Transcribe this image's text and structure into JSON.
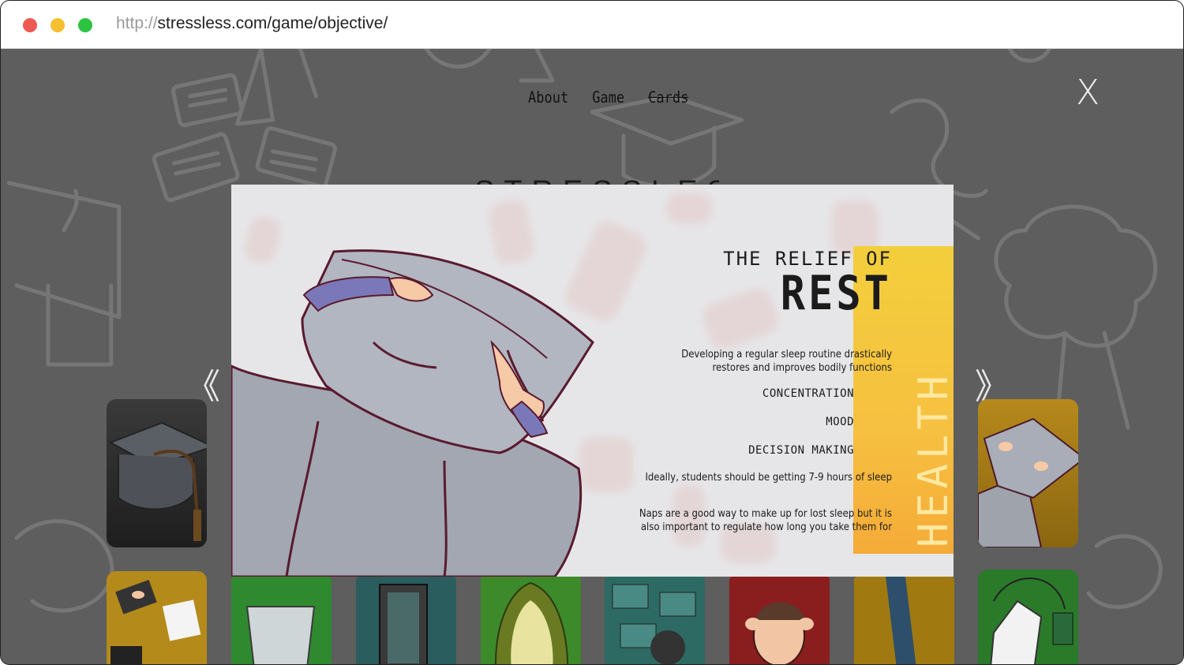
{
  "browser": {
    "url_scheme": "http://",
    "url_rest": "stressless.com/game/objective/"
  },
  "nav": {
    "about": "About",
    "game": "Game",
    "cards": "Cards"
  },
  "close_label": "X",
  "behind_title": "STRESSLESS",
  "arrows": {
    "prev": "《",
    "next": "》"
  },
  "modal": {
    "title_small": "THE RELIEF OF",
    "title_big": "REST",
    "intro_line1": "Developing a regular sleep routine drastically",
    "intro_line2": "restores and improves bodily functions",
    "benefits": [
      "CONCENTRATION",
      "MOOD",
      "DECISION MAKING"
    ],
    "hours_note": "Ideally, students should be getting 7-9 hours of sleep",
    "naps_line1": "Naps are a good way to make up for lost sleep but it is",
    "naps_line2": "also important to regulate how long you take them for",
    "category": "HEALTH"
  },
  "colors": {
    "accent_yellow": "#f5c23c",
    "background_gray": "#5e5e5e",
    "modal_bg": "#e6e6e8"
  },
  "cards": [
    {
      "name": "graduation-cap-card",
      "color": "#2b2b2b"
    },
    {
      "name": "study-desk-card",
      "color": "#b48a1a"
    },
    {
      "name": "water-glass-card",
      "color": "#2f8a2f"
    },
    {
      "name": "phone-card",
      "color": "#2a5d5d"
    },
    {
      "name": "avocado-card",
      "color": "#3d8a2a"
    },
    {
      "name": "notes-card",
      "color": "#2c6a63"
    },
    {
      "name": "stress-face-card",
      "color": "#8a1d1d"
    },
    {
      "name": "walking-card",
      "color": "#a07a10"
    },
    {
      "name": "tea-bag-card",
      "color": "#2a7a2a"
    },
    {
      "name": "rest-pillow-card",
      "color": "#a27a12"
    }
  ]
}
